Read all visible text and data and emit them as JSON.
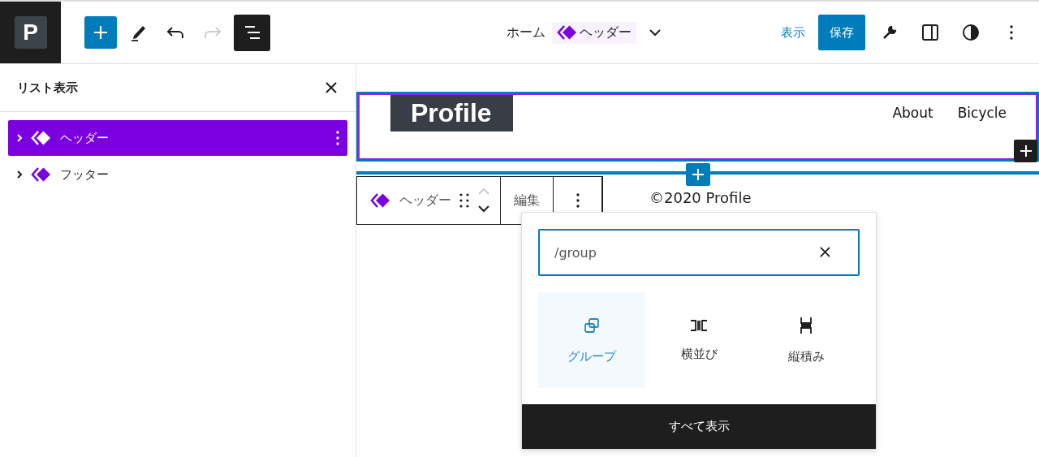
{
  "topbar": {
    "logo": "P",
    "tools": [
      {
        "kind": "inserter",
        "selected": true,
        "disabled": false
      },
      {
        "kind": "edit",
        "selected": false,
        "disabled": false
      },
      {
        "kind": "undo",
        "selected": false,
        "disabled": false
      },
      {
        "kind": "redo",
        "selected": false,
        "disabled": true
      },
      {
        "kind": "list_view",
        "selected": true,
        "disabled": false
      }
    ],
    "breadcrumb": {
      "home": "ホーム",
      "current": "ヘッダー"
    },
    "view_link": "表示",
    "save_button": "保存"
  },
  "sidebar": {
    "title": "リスト表示",
    "items": [
      {
        "label": "ヘッダー",
        "selected": true,
        "expanded": false
      },
      {
        "label": "フッター",
        "selected": false,
        "expanded": false
      }
    ]
  },
  "canvas": {
    "header": {
      "logo": "Profile",
      "nav": [
        "About",
        "Bicycle"
      ]
    },
    "block_toolbar": {
      "label": "ヘッダー",
      "edit": "編集"
    },
    "footer_text": "©2020 Profile"
  },
  "popover": {
    "search": {
      "value": "/group"
    },
    "results": [
      {
        "kind": "group",
        "label": "グループ",
        "selected": true
      },
      {
        "kind": "row",
        "label": "横並び",
        "selected": false
      },
      {
        "kind": "stack",
        "label": "縦積み",
        "selected": false
      }
    ],
    "show_all": "すべて表示"
  }
}
